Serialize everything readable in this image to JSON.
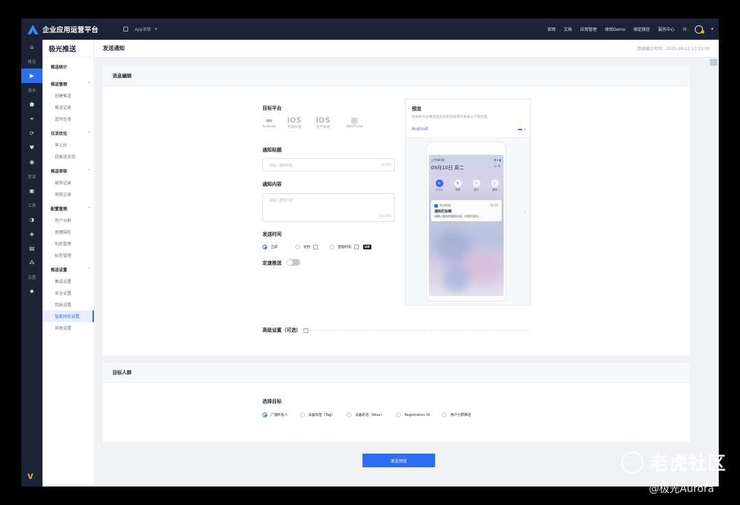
{
  "topbar": {
    "brand": "企业应用运营平台",
    "app_select": "App名称",
    "nav": [
      "官网",
      "文档",
      "应用管理",
      "体验Demo",
      "绑定微信",
      "服务中心"
    ]
  },
  "rail": {
    "items": [
      {
        "type": "icon",
        "icon": "home-icon",
        "glyph": "⌂"
      },
      {
        "type": "label",
        "text": "推送"
      },
      {
        "type": "icon",
        "icon": "push-icon",
        "glyph": "▶",
        "active": true
      },
      {
        "type": "label",
        "text": "增长"
      },
      {
        "type": "icon",
        "icon": "shield-icon",
        "glyph": "⬟"
      },
      {
        "type": "icon",
        "icon": "link-icon",
        "glyph": "⚭"
      },
      {
        "type": "icon",
        "icon": "sync-icon",
        "glyph": "⟳"
      },
      {
        "type": "icon",
        "icon": "heart-icon",
        "glyph": "♥"
      },
      {
        "type": "icon",
        "icon": "target-icon",
        "glyph": "◉"
      },
      {
        "type": "label",
        "text": "变现"
      },
      {
        "type": "icon",
        "icon": "wallet-icon",
        "glyph": "▣"
      },
      {
        "type": "label",
        "text": "工具"
      },
      {
        "type": "icon",
        "icon": "chart-icon",
        "glyph": "◑"
      },
      {
        "type": "icon",
        "icon": "tag-icon",
        "glyph": "◈"
      },
      {
        "type": "icon",
        "icon": "message-icon",
        "glyph": "▤"
      },
      {
        "type": "icon",
        "icon": "network-icon",
        "glyph": "⁂"
      },
      {
        "type": "label",
        "text": "设置"
      },
      {
        "type": "icon",
        "icon": "gear-icon",
        "glyph": "✹"
      }
    ],
    "bottom_logo": "V"
  },
  "sidebar": {
    "title": "极光推送",
    "groups": [
      {
        "label": "推送统计",
        "collapsible": false,
        "items": []
      },
      {
        "label": "推送管理",
        "collapsible": true,
        "items": [
          "创建推送",
          "推送记录",
          "定时任务"
        ]
      },
      {
        "label": "日活优化",
        "collapsible": true,
        "items": [
          "早上好",
          "轻推送支持"
        ]
      },
      {
        "label": "推送审核",
        "collapsible": true,
        "items": [
          "被审记录",
          "审核记录"
        ]
      },
      {
        "label": "配置管理",
        "collapsible": true,
        "items": [
          "用户分群",
          "地理围栏",
          "别名管理",
          "标签管理"
        ]
      },
      {
        "label": "推送设置",
        "collapsible": true,
        "items": [
          "集成设置",
          "安全设置",
          "回执设置",
          "智能时机设置",
          "其他设置"
        ]
      }
    ],
    "active_item": "智能时机设置"
  },
  "header": {
    "title": "发送通知",
    "timestamp": "数据截止时间：2020-09-12  17:23:00"
  },
  "message_card": {
    "title": "消息编辑",
    "platform_label": "目标平台",
    "platforms": [
      {
        "name": "Android",
        "glyph": "▬"
      },
      {
        "name": "开发环境",
        "glyph": "iOS"
      },
      {
        "name": "生产环境",
        "glyph": "iOS"
      },
      {
        "name": "WinPhone",
        "glyph": "▦"
      }
    ],
    "notify_title_label": "通知标题",
    "notify_title_placeholder": "请输入通知标题",
    "notify_title_count": "0/160",
    "notify_content_label": "通知内容",
    "notify_content_placeholder": "请输入通知内容",
    "notify_content_count": "0/1000",
    "send_time_label": "发送时间",
    "send_time_options": [
      "立即",
      "定时",
      "智能时机"
    ],
    "send_time_selected": "立即",
    "vip": "VIP",
    "speed_label": "定速推送",
    "advanced": "高级设置（可选）"
  },
  "preview": {
    "title": "预览",
    "subtitle": "各目标平台推送送达的实际效果可参考以下预览图。",
    "tab": "Android",
    "phone": {
      "time": "上午08:08",
      "status": "✻ ▾ ▮",
      "date": "09月10日  周二",
      "toggles": [
        {
          "label": "WLAN",
          "glyph": "≋",
          "on": true
        },
        {
          "label": "数据",
          "glyph": "⇅",
          "on": false
        },
        {
          "label": "蓝牙",
          "glyph": "ᛒ",
          "on": false
        },
        {
          "label": "静音",
          "glyph": "♪",
          "on": false
        }
      ],
      "notif_app": "推送助理",
      "notif_time": "10:10",
      "notif_title": "通知栏标题",
      "notif_body": "请输入推送的通知内容。内容内容内..."
    }
  },
  "target_card": {
    "title": "目标人群",
    "select_label": "选择目标",
    "options": [
      "广播所有人",
      "设备标签（Tag）",
      "设备别名（Alias）",
      "Registration ID",
      "用户分群推送"
    ],
    "selected": "广播所有人"
  },
  "submit_label": "发送预览",
  "watermark": {
    "line1": "老虎社区",
    "line2": "@极光Aurora"
  },
  "colors": {
    "accent": "#2d6ff0",
    "dark": "#1b2336",
    "vip": "#f5b400"
  }
}
